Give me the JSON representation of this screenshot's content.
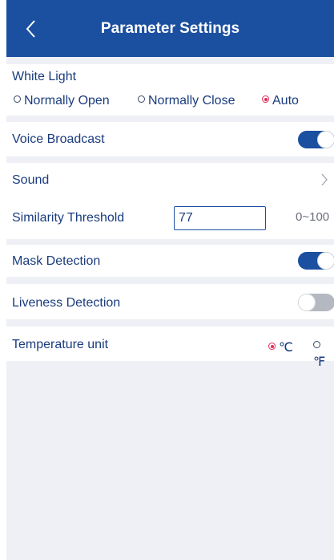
{
  "header": {
    "title": "Parameter Settings",
    "back_icon": "chevron-left-icon"
  },
  "white_light": {
    "label": "White Light",
    "options": [
      {
        "label": "Normally Open",
        "selected": false
      },
      {
        "label": "Normally Close",
        "selected": false
      },
      {
        "label": "Auto",
        "selected": true
      }
    ]
  },
  "voice_broadcast": {
    "label": "Voice Broadcast",
    "enabled": true
  },
  "sound": {
    "label": "Sound",
    "icon": "chevron-right-icon"
  },
  "similarity_threshold": {
    "label": "Similarity Threshold",
    "value": "77",
    "range": "0~100"
  },
  "mask_detection": {
    "label": "Mask Detection",
    "enabled": true
  },
  "liveness_detection": {
    "label": "Liveness Detection",
    "enabled": false
  },
  "temperature_unit": {
    "label": "Temperature unit",
    "options": [
      {
        "label": "℃",
        "selected": true
      },
      {
        "label": "℉",
        "selected": false
      }
    ]
  },
  "colors": {
    "header_bg": "#1b4fa0",
    "label_text": "#1a3c7e",
    "accent_radio": "#e02c5a",
    "page_bg": "#eef0f5"
  }
}
